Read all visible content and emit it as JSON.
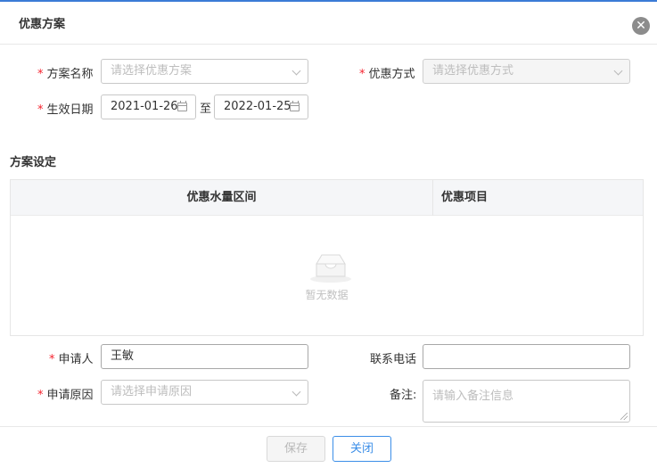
{
  "dialog": {
    "title": "优惠方案",
    "close_icon": "close-icon",
    "close_glyph": "✕"
  },
  "form": {
    "scheme_name": {
      "label": "方案名称",
      "required_mark": "*",
      "placeholder": "请选择优惠方案"
    },
    "discount_mode": {
      "label": "优惠方式",
      "required_mark": "*",
      "placeholder": "请选择优惠方式"
    },
    "effective_date": {
      "label": "生效日期",
      "required_mark": "*",
      "start": "2021-01-26",
      "separator": "至",
      "end": "2022-01-25"
    },
    "applicant": {
      "label": "申请人",
      "required_mark": "*",
      "value": "王敏"
    },
    "phone": {
      "label": "联系电话",
      "value": ""
    },
    "reason": {
      "label": "申请原因",
      "required_mark": "*",
      "placeholder": "请选择申请原因"
    },
    "remark": {
      "label": "备注:",
      "placeholder": "请输入备注信息"
    }
  },
  "scheme_settings": {
    "section_title": "方案设定",
    "columns": [
      "优惠水量区间",
      "优惠项目"
    ],
    "rows": [],
    "empty_text": "暂无数据"
  },
  "footer": {
    "save_label": "保存",
    "close_label": "关闭"
  },
  "colors": {
    "accent": "#3b8ee8",
    "required": "#f5222d",
    "header_bg": "#f5f6f8"
  }
}
